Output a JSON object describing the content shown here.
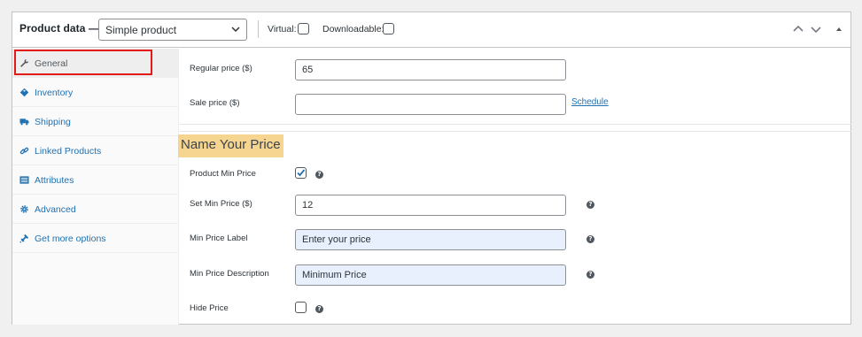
{
  "header": {
    "title": "Product data —",
    "product_type": "Simple product",
    "virtual_label": "Virtual:",
    "downloadable_label": "Downloadable:"
  },
  "sidebar": {
    "items": [
      {
        "label": "General",
        "icon": "wrench-icon",
        "active": true
      },
      {
        "label": "Inventory",
        "icon": "tag-icon",
        "active": false
      },
      {
        "label": "Shipping",
        "icon": "truck-icon",
        "active": false
      },
      {
        "label": "Linked Products",
        "icon": "link-icon",
        "active": false
      },
      {
        "label": "Attributes",
        "icon": "list-icon",
        "active": false
      },
      {
        "label": "Advanced",
        "icon": "gear-icon",
        "active": false
      },
      {
        "label": "Get more options",
        "icon": "plugin-icon",
        "active": false
      }
    ]
  },
  "pricing": {
    "regular_price_label": "Regular price ($)",
    "regular_price_value": "65",
    "sale_price_label": "Sale price ($)",
    "sale_price_value": "",
    "schedule_link": "Schedule"
  },
  "nyp": {
    "section_title": "Name Your Price",
    "min_price_toggle_label": "Product Min Price",
    "min_price_toggle_checked": true,
    "set_min_price_label": "Set Min Price ($)",
    "set_min_price_value": "12",
    "min_price_label_label": "Min Price Label",
    "min_price_label_value": "Enter your price",
    "min_price_desc_label": "Min Price Description",
    "min_price_desc_value": "Minimum Price",
    "hide_price_label": "Hide Price",
    "hide_price_checked": false,
    "help_glyph": "?"
  },
  "colors": {
    "accent": "#2271b1",
    "highlight": "#f5d58f",
    "active_outline": "#e21a1a",
    "autofill": "#e8f0fe"
  }
}
